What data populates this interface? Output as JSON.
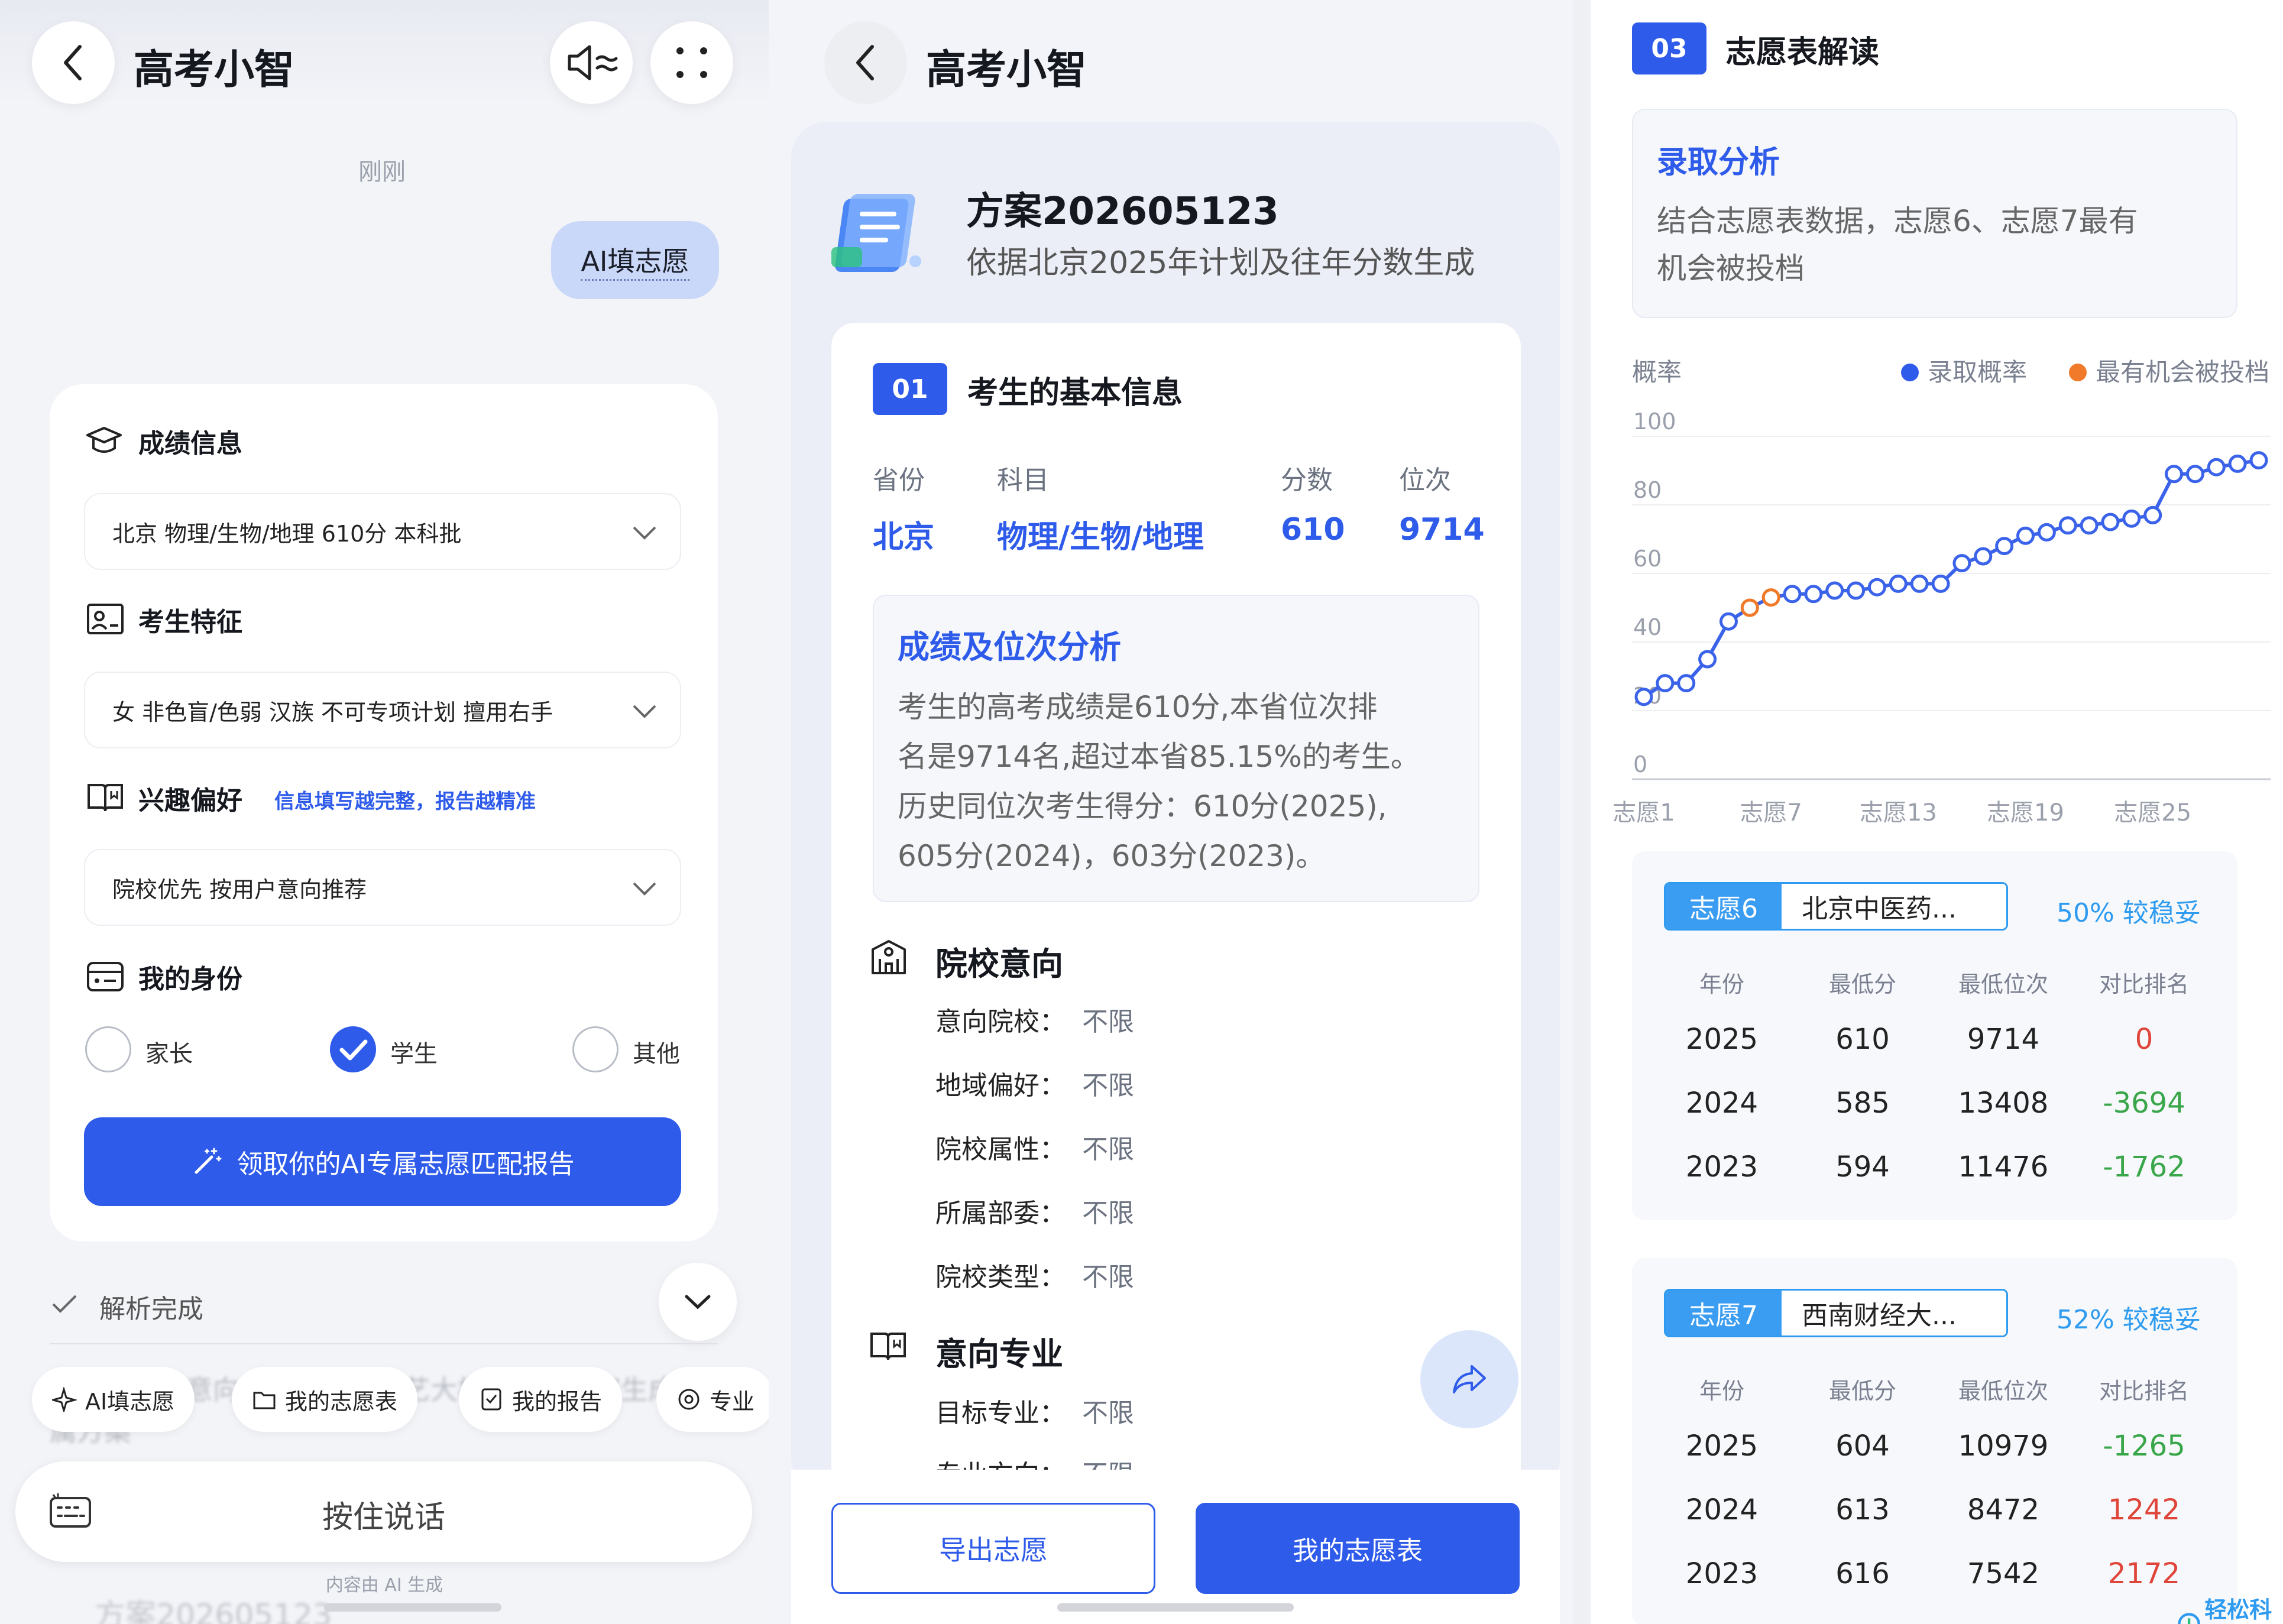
{
  "left": {
    "header": {
      "title": "高考小智"
    },
    "timestamp": "刚刚",
    "user_message": "AI填志愿",
    "form": {
      "score_section": "成绩信息",
      "score_value": "北京 物理/生物/地理 610分 本科批",
      "feature_section": "考生特征",
      "feature_value": "女 非色盲/色弱 汉族 不可专项计划 擅用右手",
      "interest_section": "兴趣偏好",
      "interest_hint": "信息填写越完整，报告越精准",
      "interest_value": "院校优先 按用户意向推荐",
      "identity_section": "我的身份",
      "options": [
        {
          "label": "家长",
          "checked": false
        },
        {
          "label": "学生",
          "checked": true
        },
        {
          "label": "其他",
          "checked": false
        }
      ],
      "submit_label": "领取你的AI专属志愿匹配报告"
    },
    "parse_status": "解析完成",
    "faded_text": "基于提供的意向数据，结合小艺大模型，已为您生成专属方案",
    "chips": [
      "AI填志愿",
      "我的志愿表",
      "我的报告",
      "专业"
    ],
    "voice_label": "按住说话",
    "footer_note": "内容由 AI 生成",
    "faded_bottom": "方案202605123"
  },
  "middle": {
    "header": {
      "title": "高考小智"
    },
    "plan": {
      "name": "方案202605123",
      "subtitle": "依据北京2025年计划及往年分数生成"
    },
    "section1": {
      "index": "01",
      "title": "考生的基本信息",
      "labels": [
        "省份",
        "科目",
        "分数",
        "位次"
      ],
      "values": [
        "北京",
        "物理/生物/地理",
        "610",
        "9714"
      ]
    },
    "analysis": {
      "title": "成绩及位次分析",
      "lines": [
        "考生的高考成绩是610分,本省位次排",
        "名是9714名,超过本省85.15%的考生。",
        "历史同位次考生得分：610分(2025),",
        "605分(2024)，603分(2023)。"
      ]
    },
    "school_intent": {
      "title": "院校意向",
      "rows": [
        {
          "k": "意向院校：",
          "v": "不限"
        },
        {
          "k": "地域偏好：",
          "v": "不限"
        },
        {
          "k": "院校属性：",
          "v": "不限"
        },
        {
          "k": "所属部委：",
          "v": "不限"
        },
        {
          "k": "院校类型：",
          "v": "不限"
        }
      ]
    },
    "major_intent": {
      "title": "意向专业",
      "rows": [
        {
          "k": "目标专业：",
          "v": "不限"
        },
        {
          "k": "专业方向：",
          "v": "不限"
        }
      ]
    },
    "buttons": {
      "export": "导出志愿",
      "my_table": "我的志愿表"
    }
  },
  "right": {
    "section3": {
      "index": "03",
      "title": "志愿表解读"
    },
    "admission": {
      "title": "录取分析",
      "lines": [
        "结合志愿表数据，志愿6、志愿7最有",
        "机会被投档"
      ]
    },
    "chart_data": {
      "type": "line",
      "ylabel": "概率",
      "ylim": [
        0,
        100
      ],
      "yticks": [
        0,
        20,
        40,
        60,
        80,
        100
      ],
      "xticks": [
        "志愿1",
        "志愿7",
        "志愿13",
        "志愿19",
        "志愿25"
      ],
      "legend": [
        {
          "name": "录取概率",
          "color": "#2e5bea"
        },
        {
          "name": "最有机会被投档",
          "color": "#f07a2a"
        }
      ],
      "legend_position": "top-right",
      "x": [
        1,
        2,
        3,
        4,
        5,
        6,
        7,
        8,
        9,
        10,
        11,
        12,
        13,
        14,
        15,
        16,
        17,
        18,
        19,
        20,
        21,
        22,
        23,
        24,
        25,
        26,
        27,
        28,
        29,
        30
      ],
      "values": [
        24,
        28,
        28,
        35,
        46,
        50,
        53,
        54,
        54,
        55,
        55,
        56,
        57,
        57,
        57,
        63,
        65,
        68,
        71,
        72,
        74,
        74,
        75,
        76,
        77,
        89,
        89,
        91,
        92,
        93
      ],
      "highlight_x": [
        6,
        7
      ]
    },
    "cards": [
      {
        "tag": "志愿6",
        "school": "北京中医药...",
        "prob": "50% 较稳妥",
        "headers": [
          "年份",
          "最低分",
          "最低位次",
          "对比排名"
        ],
        "rows": [
          {
            "year": "2025",
            "score": "610",
            "rank": "9714",
            "diff": "0",
            "sign": "zero"
          },
          {
            "year": "2024",
            "score": "585",
            "rank": "13408",
            "diff": "-3694",
            "sign": "neg"
          },
          {
            "year": "2023",
            "score": "594",
            "rank": "11476",
            "diff": "-1762",
            "sign": "neg"
          }
        ]
      },
      {
        "tag": "志愿7",
        "school": "西南财经大...",
        "prob": "52% 较稳妥",
        "headers": [
          "年份",
          "最低分",
          "最低位次",
          "对比排名"
        ],
        "rows": [
          {
            "year": "2025",
            "score": "604",
            "rank": "10979",
            "diff": "-1265",
            "sign": "neg"
          },
          {
            "year": "2024",
            "score": "613",
            "rank": "8472",
            "diff": "1242",
            "sign": "pos"
          },
          {
            "year": "2023",
            "score": "616",
            "rank": "7542",
            "diff": "2172",
            "sign": "pos"
          }
        ]
      }
    ],
    "watermark": "轻松科技"
  }
}
